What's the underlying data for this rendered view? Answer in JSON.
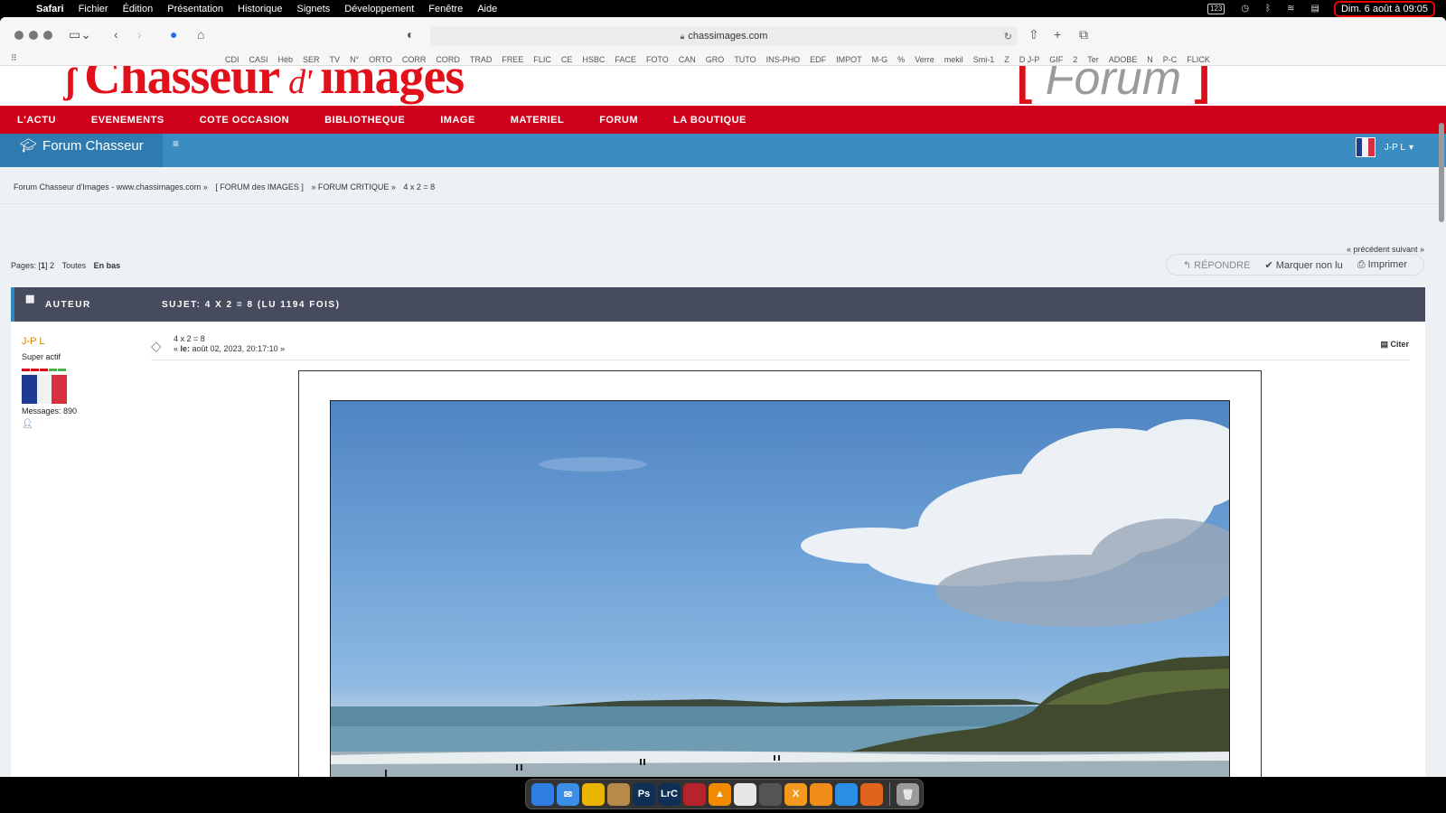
{
  "menubar": {
    "app": "Safari",
    "items": [
      "Fichier",
      "Édition",
      "Présentation",
      "Historique",
      "Signets",
      "Développement",
      "Fenêtre",
      "Aide"
    ],
    "status_icons": [
      "keyboard-123-icon",
      "time-machine-icon",
      "bluetooth-icon",
      "wifi-icon",
      "control-center-icon"
    ],
    "keyboard_label": "123",
    "clock": "Dim. 6 août à 09:05",
    "clock_highlight_color": "#e00000"
  },
  "browser": {
    "url": "chassimages.com",
    "favorites": [
      "CDI",
      "CASI",
      "Héb",
      "SER",
      "TV",
      "N°",
      "ORTO",
      "CORR",
      "CORD",
      "TRAD",
      "FREE",
      "FLIC",
      "CE",
      "HSBC",
      "FACE",
      "FOTO",
      "CAN",
      "GRO",
      "TUTO",
      "INS-PHO",
      "EDF",
      "IMPOT",
      "M-G",
      "%",
      "Verre",
      "mekil",
      "Smi-1",
      "Z",
      "D J-P",
      "GIF",
      "2",
      "Ter",
      "ADOBE",
      "N",
      "P-C",
      "FLICK"
    ]
  },
  "site": {
    "logo_text": "Chasseur d'images",
    "logo_main_1": "Chasseur",
    "logo_d": "d'",
    "logo_main_2": "images",
    "forum_logo": "Forum",
    "forum_bracket_left": "[",
    "forum_bracket_right": "]",
    "brand_red": "#d0021b",
    "forum_blue": "#3b8cc0",
    "nav": [
      "L'ACTU",
      "EVENEMENTS",
      "COTE OCCASION",
      "BIBLIOTHEQUE",
      "IMAGE",
      "MATERIEL",
      "FORUM",
      "LA BOUTIQUE"
    ],
    "forum_title": "Forum Chasseur",
    "user": "J-P L"
  },
  "breadcrumb": {
    "items": [
      "Forum Chasseur d'Images - www.chassimages.com »",
      "[ FORUM des IMAGES ]",
      "» FORUM CRITIQUE »",
      "4 x 2 = 8"
    ]
  },
  "topic": {
    "nav_links": "« précédent suivant »",
    "pages_label": "Pages: [",
    "current_page": "1",
    "pages_rest": "] 2",
    "all_label": "Toutes",
    "bottom_label": "En bas",
    "actions": {
      "reply": "RÉPONDRE",
      "mark_unread": "Marquer non lu",
      "print": "Imprimer"
    },
    "header_author": "AUTEUR",
    "header_subject": "SUJET: 4 X 2 = 8  (LU 1194 FOIS)"
  },
  "post": {
    "author": "J-P L",
    "rank": "Super actif",
    "messages": "Messages: 890",
    "subject": "4 x 2 = 8",
    "date_prefix": "« ",
    "date_label": "le:",
    "date": " août 02, 2023, 20:17:10 »",
    "quote": "Citer"
  },
  "dock": {
    "apps": [
      {
        "name": "finder-icon",
        "color": "#2f7de1",
        "label": ""
      },
      {
        "name": "mail-icon",
        "color": "#3a8ee6",
        "label": "✉"
      },
      {
        "name": "chrome-icon",
        "color": "#e8b400",
        "label": ""
      },
      {
        "name": "notes-brown-icon",
        "color": "#b88a4a",
        "label": ""
      },
      {
        "name": "photoshop-icon",
        "color": "#0f2f54",
        "label": "Ps"
      },
      {
        "name": "lightroom-classic-icon",
        "color": "#0f2f54",
        "label": "LrC"
      },
      {
        "name": "photo-app-icon",
        "color": "#b5242a",
        "label": ""
      },
      {
        "name": "vlc-icon",
        "color": "#f08a00",
        "label": "▲"
      },
      {
        "name": "textedit-icon",
        "color": "#e6e6e6",
        "label": ""
      },
      {
        "name": "calculator-icon",
        "color": "#555555",
        "label": ""
      },
      {
        "name": "x-app-icon",
        "color": "#f39a1e",
        "label": "X"
      },
      {
        "name": "pages-icon",
        "color": "#f08c1a",
        "label": ""
      },
      {
        "name": "safari-icon",
        "color": "#2b8fe6",
        "label": ""
      },
      {
        "name": "firefox-icon",
        "color": "#e0641c",
        "label": ""
      }
    ],
    "trash": "trash-icon"
  }
}
